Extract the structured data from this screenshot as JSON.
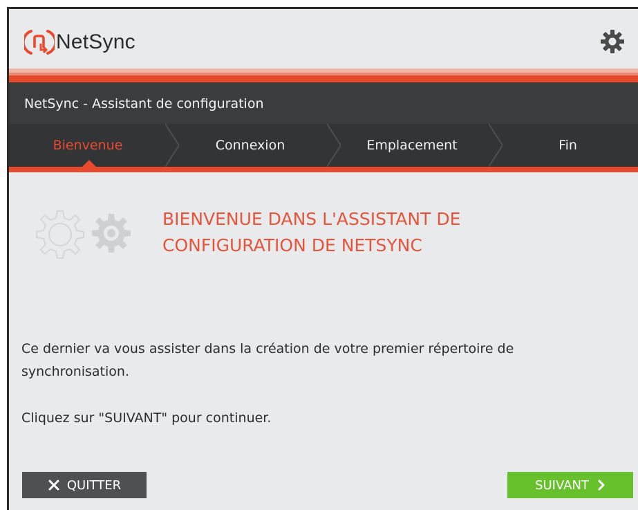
{
  "app": {
    "name": "NetSync",
    "window_title": "NetSync - Assistant de configuration"
  },
  "steps": [
    {
      "label": "Bienvenue",
      "active": true
    },
    {
      "label": "Connexion",
      "active": false
    },
    {
      "label": "Emplacement",
      "active": false
    },
    {
      "label": "Fin",
      "active": false
    }
  ],
  "welcome": {
    "line1": "BIENVENUE DANS L'ASSISTANT DE",
    "line2": "CONFIGURATION DE NETSYNC"
  },
  "body": {
    "description": "Ce dernier va vous assister dans la création de votre premier répertoire de synchronisation.",
    "instruction": "Cliquez sur \"SUIVANT\" pour continuer."
  },
  "buttons": {
    "quit": "QUITTER",
    "next": "SUIVANT"
  },
  "icons": {
    "logo": "netsync-logo-icon",
    "settings": "gear-icon",
    "hero": "gears-icon",
    "quit": "close-icon",
    "next": "chevron-right-icon"
  },
  "colors": {
    "accent": "#e84a2e",
    "dark_bar": "#3b3c3e",
    "next_button": "#67c12d",
    "quit_button": "#4f5052",
    "background": "#e9eaec"
  }
}
